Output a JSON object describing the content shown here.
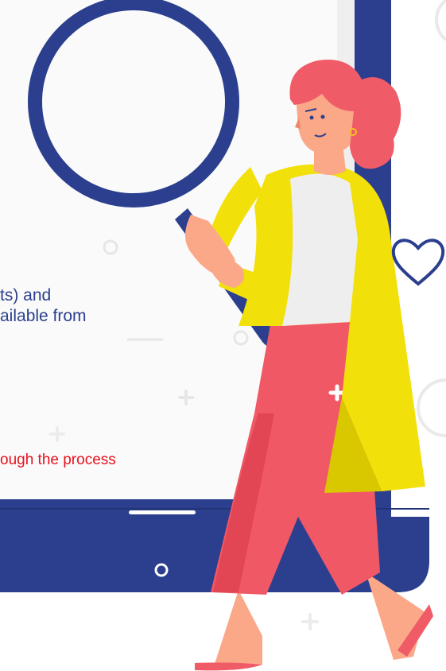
{
  "text_lines": [
    "ts) and",
    "ailable from"
  ],
  "highlight_line": "ough the process",
  "colors": {
    "navy": "#2b3f8e",
    "red_text": "#e8111e",
    "screen": "#fafafa",
    "skin": "#fba889",
    "hair": "#ef5c68",
    "cardigan": "#f2e00a",
    "pants": "#f05866",
    "shirt": "#efeeee"
  },
  "icons": [
    "magnifying-glass-icon",
    "heart-icon",
    "plus-icon",
    "circle-icon"
  ]
}
